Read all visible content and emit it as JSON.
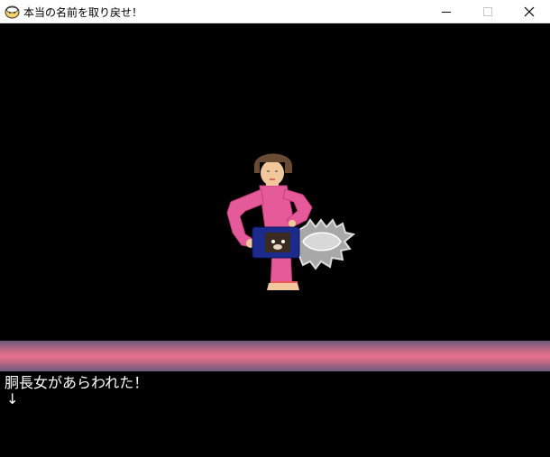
{
  "window": {
    "title": "本当の名前を取り戻せ！",
    "icon": "app-icon",
    "controls": [
      "minimize-icon",
      "maximize-icon",
      "close-icon"
    ]
  },
  "scene": {
    "enemy_name": "胴長女",
    "sprite": "chainsaw-woman-sprite",
    "band_colors": [
      "#6e5a7a",
      "#b86683",
      "#e0708a"
    ]
  },
  "message": {
    "text": "胴長女があらわれた！",
    "continue_marker": "↓"
  }
}
